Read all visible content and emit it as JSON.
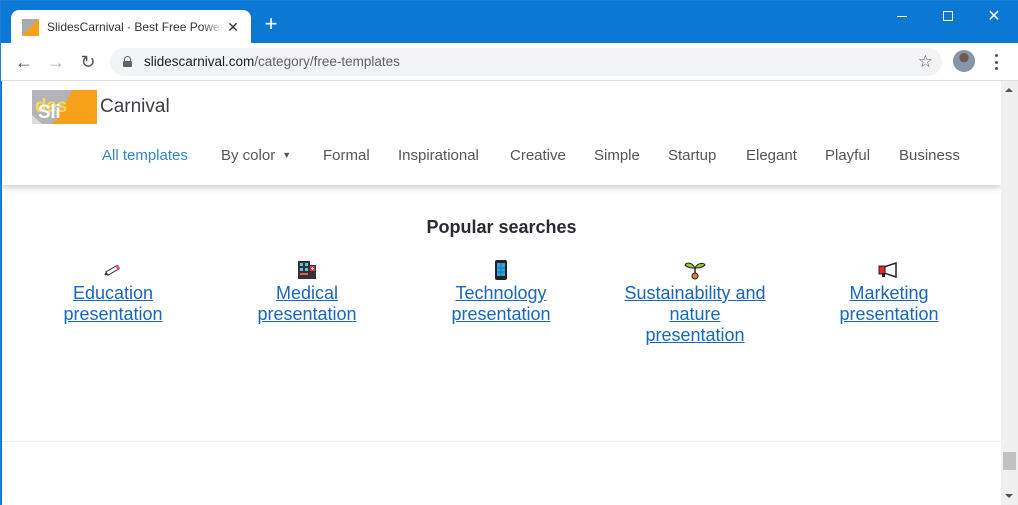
{
  "browser": {
    "tab_title": "SlidesCarnival · Best Free PowerPoint templates and Google Slides themes",
    "tab_close_glyph": "✕",
    "new_tab_glyph": "+",
    "url_host": "slidescarnival.com",
    "url_path": "/category/free-templates",
    "back_glyph": "←",
    "forward_glyph": "→",
    "reload_glyph": "↻",
    "star_glyph": "☆",
    "close_glyph": "✕"
  },
  "header": {
    "logo_slides_part1": "Sli",
    "logo_slides_part2": "des",
    "logo_carnival": "Carnival",
    "nav": [
      {
        "label": "All templates",
        "active": true
      },
      {
        "label": "By color",
        "caret": "▼"
      },
      {
        "label": "Formal"
      },
      {
        "label": "Inspirational"
      },
      {
        "label": "Creative"
      },
      {
        "label": "Simple"
      },
      {
        "label": "Startup"
      },
      {
        "label": "Elegant"
      },
      {
        "label": "Playful"
      },
      {
        "label": "Business"
      }
    ]
  },
  "popular": {
    "title": "Popular searches",
    "items": [
      {
        "icon": "pencil-icon",
        "line1": "Education",
        "line2": "presentation"
      },
      {
        "icon": "hospital-icon",
        "line1": "Medical",
        "line2": "presentation"
      },
      {
        "icon": "mobile-phone-icon",
        "line1": "Technology",
        "line2": "presentation"
      },
      {
        "icon": "seedling-icon",
        "line1": "Sustainability and",
        "line2": "nature",
        "line3": "presentation"
      },
      {
        "icon": "megaphone-icon",
        "line1": "Marketing",
        "line2": "presentation"
      }
    ]
  },
  "colors": {
    "accent": "#2f86d6",
    "link": "#1766c0",
    "brand_orange": "#f7a01a",
    "titlebar": "#0b78d4"
  }
}
